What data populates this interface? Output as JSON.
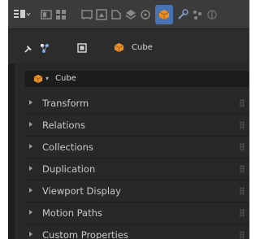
{
  "header": {
    "icons": [
      "editor-type-icon",
      "view-icon",
      "grid-icon",
      "tool-icon",
      "render-icon",
      "output-icon",
      "view-layer-icon",
      "scene-icon",
      "object-properties-icon",
      "modifiers-icon",
      "particles-icon",
      "physics-icon"
    ],
    "active_icon": "object-properties-icon",
    "accent_color": "#4772b3"
  },
  "breadcrumb": {
    "pin_icon": "pin-icon",
    "icons": [
      "scene-collection-icon",
      "object-data-icon",
      "cube-icon"
    ],
    "label": "Cube"
  },
  "object_field": {
    "icon": "cube-icon",
    "value": "Cube"
  },
  "sections": [
    {
      "label": "Transform"
    },
    {
      "label": "Relations"
    },
    {
      "label": "Collections"
    },
    {
      "label": "Duplication"
    },
    {
      "label": "Viewport Display"
    },
    {
      "label": "Motion Paths"
    },
    {
      "label": "Custom Properties"
    }
  ],
  "colors": {
    "panel_bg": "#282828",
    "header_bg": "#3b3b3b",
    "field_bg": "#1c1c1c",
    "object_orange": "#e8902a"
  }
}
